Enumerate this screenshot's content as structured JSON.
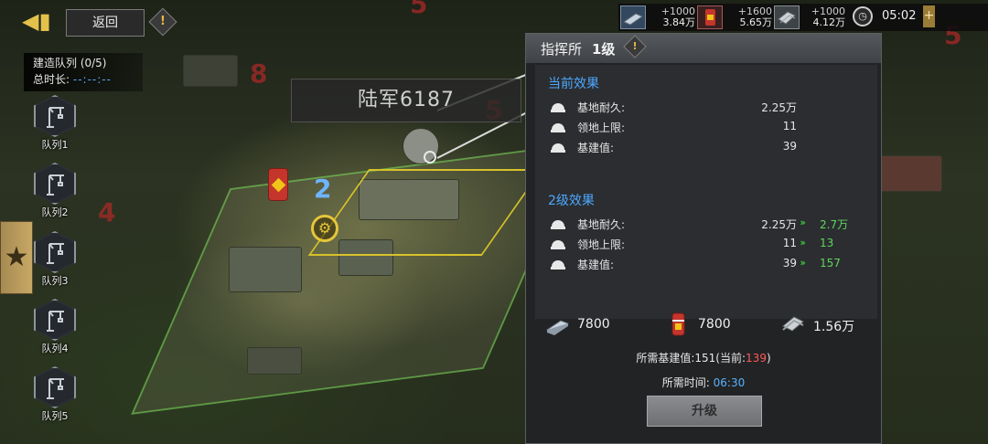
{
  "top_left": {
    "back_label": "返回"
  },
  "build_queue": {
    "title": "建造队列 (0/5)",
    "total_time_label": "总时长:",
    "total_time_value": "--:--:--",
    "items": [
      {
        "label": "队列1"
      },
      {
        "label": "队列2"
      },
      {
        "label": "队列3"
      },
      {
        "label": "队列4"
      },
      {
        "label": "队列5"
      }
    ]
  },
  "map": {
    "city_label": "陆军6187",
    "building_level_marker": "2",
    "area_numbers": [
      "8",
      "5",
      "4",
      "5",
      "5"
    ]
  },
  "resources": [
    {
      "name": "steel",
      "add": "+1000",
      "total": "3.84万",
      "icon": "steel-bar-icon"
    },
    {
      "name": "oil",
      "add": "+1600",
      "total": "5.65万",
      "icon": "oil-barrel-icon"
    },
    {
      "name": "concrete",
      "add": "+1000",
      "total": "4.12万",
      "icon": "concrete-icon"
    }
  ],
  "clock": {
    "time": "05:02",
    "plus": "+"
  },
  "panel": {
    "title": "指挥所",
    "level": "1级",
    "current_title": "当前效果",
    "current_rows": [
      {
        "label": "基地耐久:",
        "value": "2.25万"
      },
      {
        "label": "领地上限:",
        "value": "11"
      },
      {
        "label": "基建值:",
        "value": "39"
      }
    ],
    "next_title": "2级效果",
    "next_rows": [
      {
        "label": "基地耐久:",
        "value": "2.25万",
        "arrow": "›››",
        "new": "2.7万"
      },
      {
        "label": "领地上限:",
        "value": "11",
        "arrow": "›››",
        "new": "13"
      },
      {
        "label": "基建值:",
        "value": "39",
        "arrow": "›››",
        "new": "157"
      }
    ],
    "costs": [
      {
        "icon": "steel-bar-icon",
        "value": "7800"
      },
      {
        "icon": "oil-barrel-icon",
        "value": "7800"
      },
      {
        "icon": "concrete-icon",
        "value": "1.56万"
      }
    ],
    "required_base_label": "所需基建值:151(当前:",
    "required_base_current": "139",
    "required_base_close": ")",
    "required_time_label": "所需时间:",
    "required_time_value": "06:30",
    "upgrade_label": "升级"
  },
  "colors": {
    "accent_blue": "#4ea8ff",
    "upgrade_green": "#5fd65f",
    "warning_red": "#ff5a5a",
    "gold": "#e2c24a"
  }
}
